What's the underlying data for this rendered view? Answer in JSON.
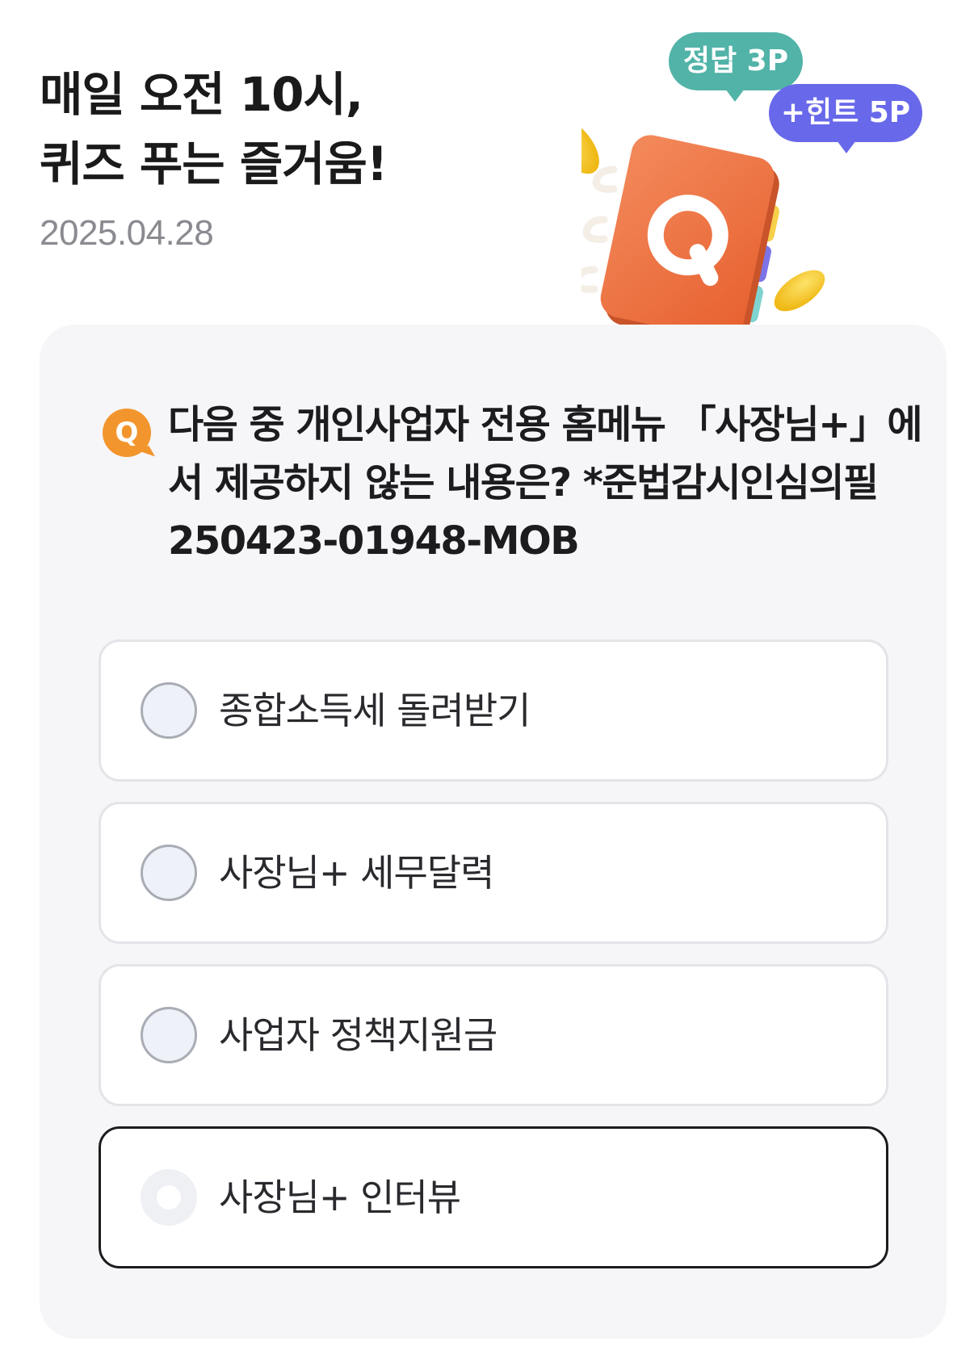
{
  "header": {
    "title_line1": "매일 오전 10시,",
    "title_line2": "퀴즈 푸는 즐거움!",
    "date": "2025.04.28"
  },
  "illustration": {
    "answer_bubble": "정답 3P",
    "hint_bubble": "+힌트 5P",
    "book_letter": "Q",
    "book_icon": "quiz-notebook-icon",
    "coin_icon": "coin-icon"
  },
  "quiz": {
    "badge": "Q",
    "question_line1": "다음 중 개인사업자 전용 홈메뉴 「사장님+」에",
    "question_line2": "서 제공하지 않는 내용은? *준법감시인심의필",
    "question_line3": "250423-01948-MOB",
    "options": [
      {
        "label": "종합소득세 돌려받기",
        "selected": false
      },
      {
        "label": "사장님+ 세무달력",
        "selected": false
      },
      {
        "label": "사업자 정책지원금",
        "selected": false
      },
      {
        "label": "사장님+ 인터뷰",
        "selected": true
      }
    ]
  },
  "colors": {
    "card_background": "#f6f6f8",
    "badge_orange": "#f3952d",
    "answer_bubble_teal": "#52b3a8",
    "hint_bubble_purple": "#6868ea",
    "book_orange": "#ee7446",
    "coin_yellow": "#f5c518",
    "selected_border": "#1c1c1e"
  }
}
